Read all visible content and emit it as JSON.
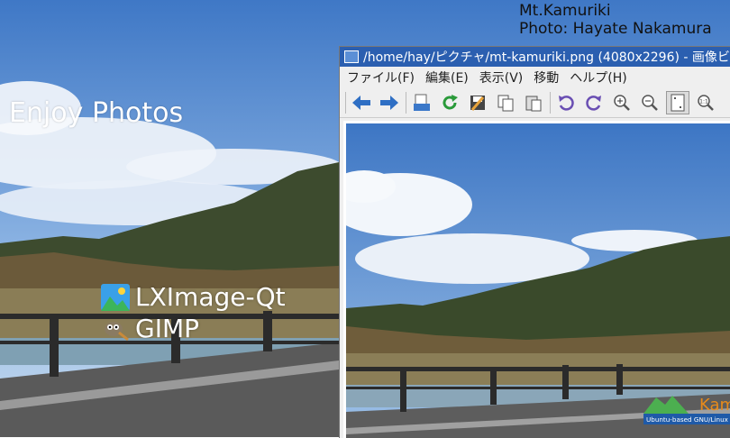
{
  "caption": {
    "line1": "Mt.Kamuriki",
    "line2": "Photo: Hayate Nakamura"
  },
  "desktop": {
    "heading": "Enjoy Photos",
    "launchers": [
      {
        "label": "LXImage-Qt",
        "icon": "lximage-icon"
      },
      {
        "label": "GIMP",
        "icon": "gimp-icon"
      }
    ]
  },
  "window": {
    "title": "/home/hay/ピクチャ/mt-kamuriki.png (4080x2296) - 画像ビ",
    "menu": [
      {
        "label": "ファイル(F)"
      },
      {
        "label": "編集(E)"
      },
      {
        "label": "表示(V)"
      },
      {
        "label": "移動"
      },
      {
        "label": "ヘルプ(H)"
      }
    ],
    "toolbar_icons": [
      "back-icon",
      "forward-icon",
      "open-file-icon",
      "reload-icon",
      "save-icon",
      "copy-icon",
      "paste-icon",
      "rotate-ccw-icon",
      "rotate-cw-icon",
      "zoom-in-icon",
      "zoom-out-icon",
      "fit-page-icon",
      "zoom-original-icon"
    ]
  },
  "watermark": {
    "brand": "Kam",
    "tagline": "Ubuntu-based GNU/Linux Op"
  },
  "colors": {
    "titlebar": "#2b5fb0",
    "sky": "#4a7fc8",
    "mountain": "#3b4a2c"
  }
}
